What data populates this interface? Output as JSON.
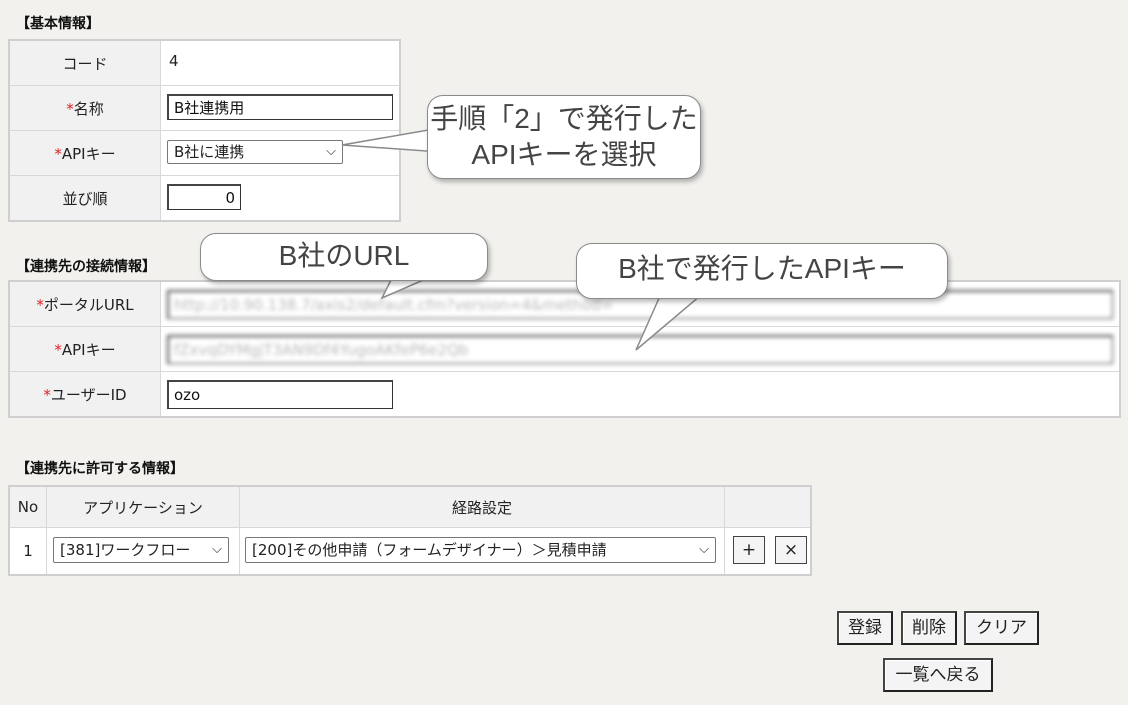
{
  "basic_info": {
    "title": "【基本情報】",
    "code_label": "コード",
    "code_value": "4",
    "name_label": "名称",
    "name_value": "B社連携用",
    "apikey_label": "APIキー",
    "apikey_selected": "B社に連携",
    "order_label": "並び順",
    "order_value": "0",
    "required_mark": "*"
  },
  "connection_info": {
    "title": "【連携先の接続情報】",
    "portal_url_label": "ポータルURL",
    "portal_url_value": "http://10.90.138.7/axis2/default.cfm?version=4&method=",
    "apikey_label": "APIキー",
    "apikey_value": "fZxvqDYMgjT3AN9Df4YugoAKfeP6e2Qb",
    "userid_label": "ユーザーID",
    "userid_value": "ozo"
  },
  "permission_info": {
    "title": "【連携先に許可する情報】",
    "columns": {
      "no": "No",
      "application": "アプリケーション",
      "route": "経路設定"
    },
    "rows": [
      {
        "no": "1",
        "application": "[381]ワークフロー",
        "route": "[200]その他申請（フォームデザイナー）＞見積申請"
      }
    ],
    "add_label": "+",
    "remove_label": "×"
  },
  "actions": {
    "register": "登録",
    "delete": "削除",
    "clear": "クリア",
    "back": "一覧へ戻る"
  },
  "callouts": {
    "select_apikey_line1": "手順「2」で発行した",
    "select_apikey_line2": "APIキーを選択",
    "company_url": "B社のURL",
    "company_apikey": "B社で発行したAPIキー"
  },
  "icons": {
    "dropdown": "chevron-down-icon"
  }
}
